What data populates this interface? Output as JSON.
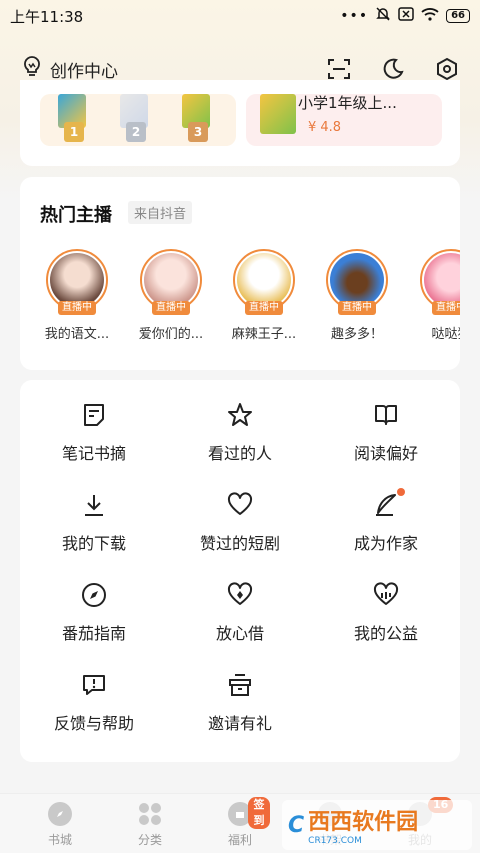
{
  "status_bar": {
    "time": "上午11:38",
    "battery": "66"
  },
  "header": {
    "title": "创作中心"
  },
  "books": {
    "ranks": [
      "1",
      "2",
      "3"
    ],
    "right_title": "小学1年级上...",
    "right_price": "¥ 4.8"
  },
  "hot": {
    "title": "热门主播",
    "source_tag": "来自抖音",
    "live_label": "直播中",
    "anchors": [
      {
        "name": "我的语文..."
      },
      {
        "name": "爱你们的..."
      },
      {
        "name": "麻辣王子..."
      },
      {
        "name": "趣多多！"
      },
      {
        "name": "哒哒猫"
      }
    ]
  },
  "features": [
    {
      "label": "笔记书摘",
      "icon": "note-icon"
    },
    {
      "label": "看过的人",
      "icon": "star-icon"
    },
    {
      "label": "阅读偏好",
      "icon": "book-icon"
    },
    {
      "label": "我的下载",
      "icon": "download-icon"
    },
    {
      "label": "赞过的短剧",
      "icon": "heart-icon"
    },
    {
      "label": "成为作家",
      "icon": "quill-icon"
    },
    {
      "label": "番茄指南",
      "icon": "compass-icon"
    },
    {
      "label": "放心借",
      "icon": "heart-shield-icon"
    },
    {
      "label": "我的公益",
      "icon": "charity-heart-icon"
    },
    {
      "label": "反馈与帮助",
      "icon": "feedback-icon"
    },
    {
      "label": "邀请有礼",
      "icon": "gift-icon"
    }
  ],
  "bottom_nav": {
    "items": [
      {
        "label": "书城",
        "icon": "compass-icon"
      },
      {
        "label": "分类",
        "icon": "grid-icon"
      },
      {
        "label": "福利",
        "icon": "gift-icon"
      },
      {
        "label": "书架",
        "icon": "bookshelf-icon"
      },
      {
        "label": "我的",
        "icon": "user-icon"
      }
    ],
    "welfare_badge": "签到",
    "me_badge": "16"
  },
  "watermark": {
    "logo": "C",
    "brand": "西西软件园",
    "domain": "CR173.COM"
  },
  "colors": {
    "accent": "#f08b3c",
    "badge": "#f06a3a"
  }
}
